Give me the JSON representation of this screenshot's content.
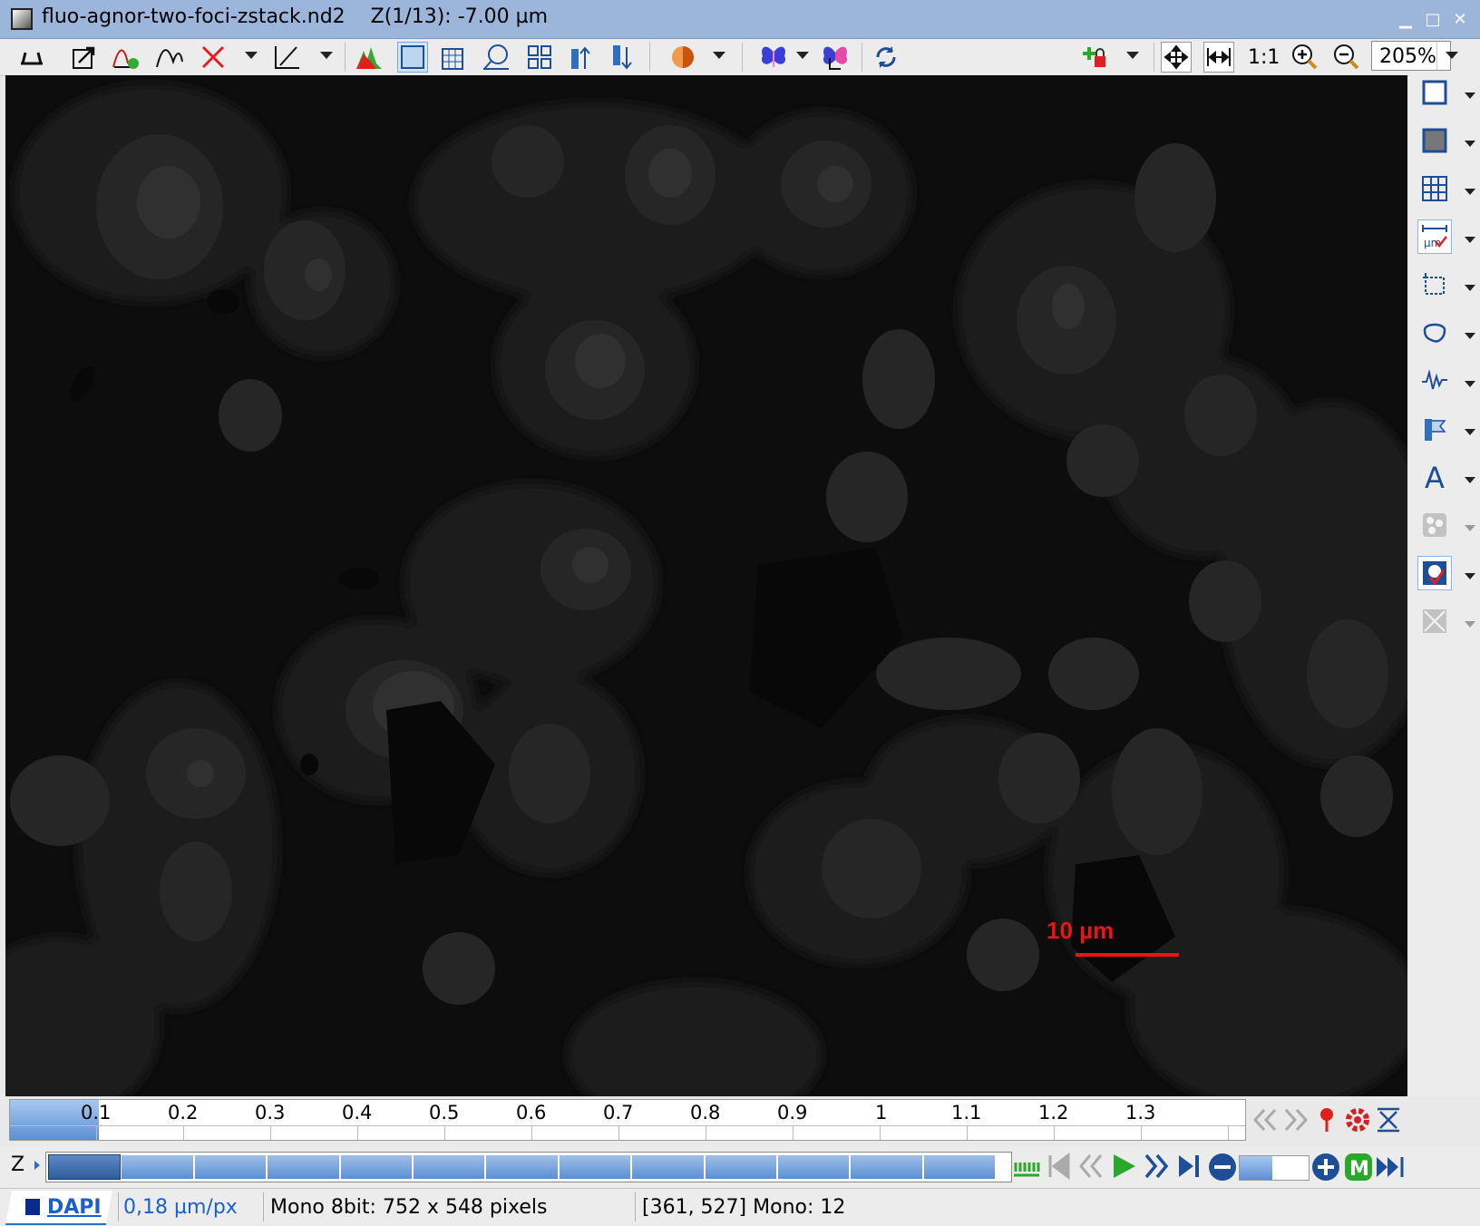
{
  "window": {
    "title": "fluo-agnor-two-foci-zstack.nd2",
    "z_info": "Z(1/13): -7.00 µm",
    "minimize_label": "▁",
    "maximize_label": "□",
    "close_label": "✕"
  },
  "toolbar": {
    "one_to_one_label": "1:1",
    "zoom_value": "205%"
  },
  "image": {
    "scale_bar_label": "10 µm",
    "scale_bar_color": "#e8141a"
  },
  "lut": {
    "ticks": [
      "0.1",
      "0.2",
      "0.3",
      "0.4",
      "0.5",
      "0.6",
      "0.7",
      "0.8",
      "0.9",
      "1",
      "1.1",
      "1.2",
      "1.3"
    ],
    "fill_fraction": 0.072
  },
  "zslider": {
    "label": "Z",
    "frame_count": 13,
    "current_frame": 1
  },
  "status": {
    "channel": "DAPI",
    "calibration": "0,18 µm/px",
    "image_info": "Mono 8bit: 752 x 548 pixels",
    "cursor_info": "[361, 527] Mono: 12"
  },
  "colors": {
    "accent": "#2f6fc0",
    "titlebar": "#9cb5db",
    "link": "#1a5fd0"
  }
}
